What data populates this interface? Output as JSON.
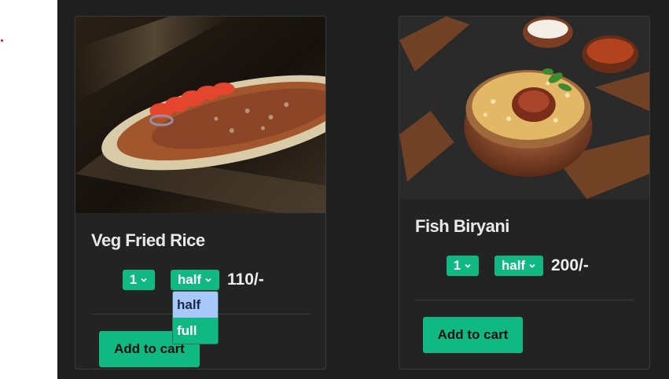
{
  "colors": {
    "accent": "#10b981",
    "panel_bg": "#1f1f1f",
    "card_bg": "#232323",
    "highlight": "#a8c7fa"
  },
  "cards": [
    {
      "title": "Veg Fried Rice",
      "image_icon": "veg-fried-rice-photo",
      "quantity": "1",
      "portion": "half",
      "price": "110/-",
      "add_label": "Add to cart"
    },
    {
      "title": "Fish Biryani",
      "image_icon": "fish-biryani-photo",
      "quantity": "1",
      "portion": "half",
      "price": "200/-",
      "add_label": "Add to cart"
    }
  ],
  "portion_dropdown": {
    "options": [
      "half",
      "full"
    ],
    "highlighted": "half"
  }
}
